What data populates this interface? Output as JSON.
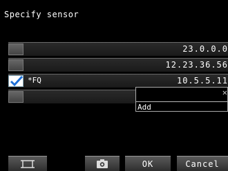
{
  "header": {
    "title": "Specify sensor"
  },
  "sensors": [
    {
      "checked": false,
      "name": "",
      "ip": "23.0.0.0"
    },
    {
      "checked": false,
      "name": "",
      "ip": "12.23.36.56"
    },
    {
      "checked": true,
      "name": "*FQ",
      "ip": "10.5.5.11"
    },
    {
      "checked": false,
      "name": "",
      "ip": ""
    }
  ],
  "popup": {
    "add_label": "Add",
    "close_label": "✕"
  },
  "toolbar": {
    "display_icon": "display-frame-icon",
    "camera_icon": "camera-icon",
    "ok_label": "OK",
    "cancel_label": "Cancel"
  },
  "colors": {
    "checkmark": "#1e6fd6",
    "background": "#000000"
  }
}
